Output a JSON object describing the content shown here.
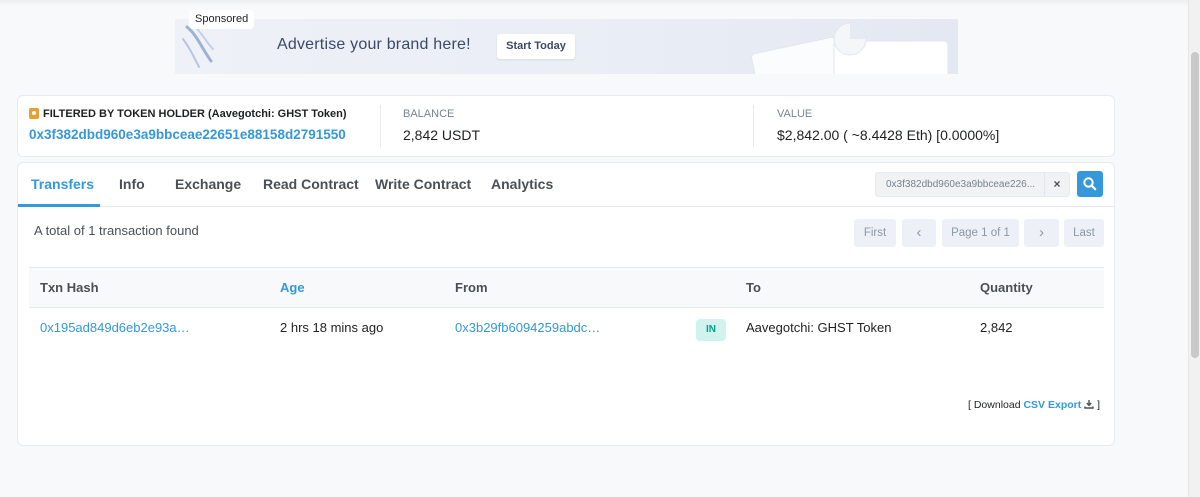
{
  "banner": {
    "sponsored_label": "Sponsored",
    "headline": "Advertise your brand here!",
    "cta_label": "Start Today"
  },
  "summary": {
    "filter_label": "FILTERED BY TOKEN HOLDER (Aavegotchi: GHST Token)",
    "holder_address": "0x3f382dbd960e3a9bbceae22651e88158d2791550",
    "balance_label": "BALANCE",
    "balance_value": "2,842 USDT",
    "value_label": "VALUE",
    "value_value": "$2,842.00 ( ~8.4428 Eth) [0.0000%]"
  },
  "tabs": [
    {
      "label": "Transfers",
      "active": true
    },
    {
      "label": "Info"
    },
    {
      "label": "Exchange"
    },
    {
      "label": "Read Contract"
    },
    {
      "label": "Write Contract"
    },
    {
      "label": "Analytics"
    }
  ],
  "search": {
    "value": "0x3f382dbd960e3a9bbceae226...",
    "clear_symbol": "×"
  },
  "results": {
    "total_text": "A total of 1 transaction found"
  },
  "pagination": {
    "first": "First",
    "prev": "‹",
    "page": "Page 1 of 1",
    "next": "›",
    "last": "Last"
  },
  "table": {
    "headers": {
      "txn_hash": "Txn Hash",
      "age": "Age",
      "from": "From",
      "to": "To",
      "quantity": "Quantity"
    },
    "rows": [
      {
        "txn_hash": "0x195ad849d6eb2e93a…",
        "age": "2 hrs 18 mins ago",
        "from": "0x3b29fb6094259abdc…",
        "direction": "IN",
        "to": "Aavegotchi: GHST Token",
        "quantity": "2,842"
      }
    ]
  },
  "export": {
    "prefix": "[ Download",
    "link": "CSV Export",
    "suffix": "]"
  },
  "colors": {
    "accent": "#3498db",
    "in_badge_bg": "#d2f3ed",
    "in_badge_text": "#00a186",
    "filter_icon": "#e7a132"
  }
}
